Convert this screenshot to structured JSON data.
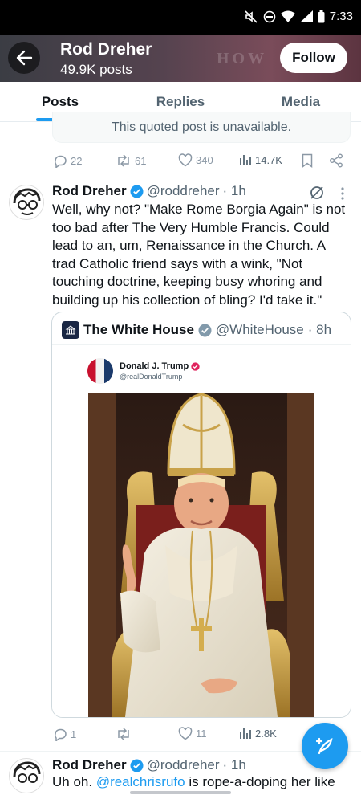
{
  "status_bar": {
    "time": "7:33"
  },
  "header": {
    "banner_text": "HOW",
    "profile_name": "Rod Dreher",
    "post_count": "49.9K posts",
    "follow_label": "Follow"
  },
  "tabs": [
    {
      "label": "Posts",
      "active": true
    },
    {
      "label": "Replies",
      "active": false
    },
    {
      "label": "Media",
      "active": false
    }
  ],
  "prev_post": {
    "quoted_unavailable": "This quoted post is unavailable.",
    "replies": "22",
    "reposts": "61",
    "likes": "340",
    "views": "14.7K"
  },
  "tweet": {
    "name": "Rod Dreher",
    "handle": "@roddreher",
    "time": "· 1h",
    "text": "Well, why not? \"Make Rome Borgia Again\" is not too bad after The Very Humble Francis. Could lead to an, um, Renaissance in the Church. A trad Catholic friend says with a wink, \"Not touching doctrine, keeping busy whoring and building up his collection of bling? I'd take it.\"",
    "quote": {
      "name": "The White House",
      "handle": "@WhiteHouse",
      "time": "· 8h",
      "inner_name": "Donald J. Trump",
      "inner_handle": "@realDonaldTrump"
    },
    "replies": "1",
    "reposts": "",
    "likes": "11",
    "views": "2.8K"
  },
  "next_tweet": {
    "name": "Rod Dreher",
    "handle": "@roddreher",
    "time": "· 1h",
    "text_start": "Uh oh. ",
    "mention": "@realchrisrufo",
    "text_end": " is rope-a-doping her like"
  },
  "colors": {
    "accent": "#1d9bf0",
    "verified": "#1d9bf0",
    "muted": "#536471"
  }
}
